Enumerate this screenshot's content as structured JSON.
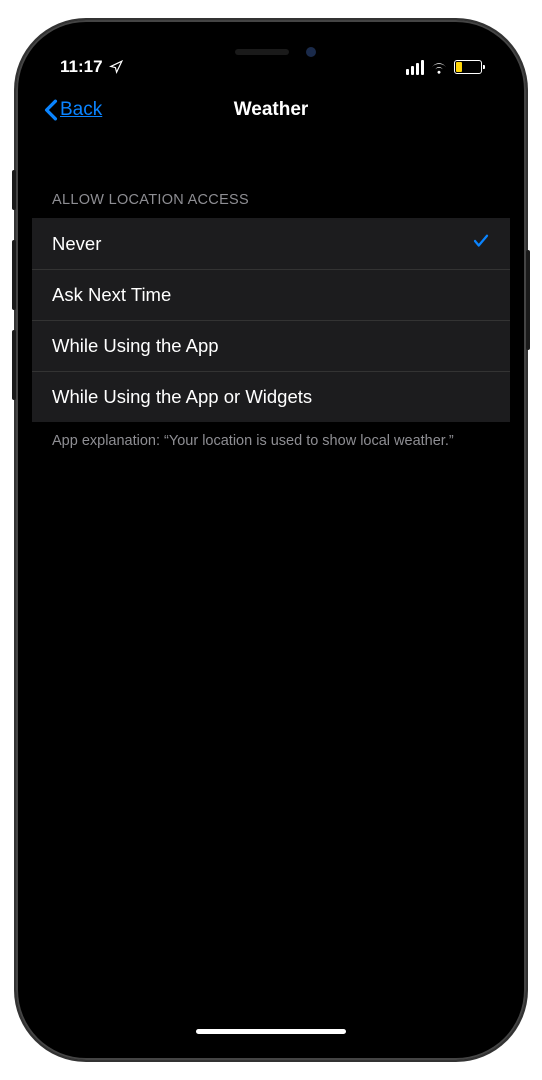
{
  "statusbar": {
    "time": "11:17"
  },
  "nav": {
    "back_label": "Back",
    "title": "Weather"
  },
  "section": {
    "header": "ALLOW LOCATION ACCESS",
    "footer": "App explanation: “Your location is used to show local weather.”"
  },
  "options": [
    {
      "label": "Never",
      "selected": true
    },
    {
      "label": "Ask Next Time",
      "selected": false
    },
    {
      "label": "While Using the App",
      "selected": false
    },
    {
      "label": "While Using the App or Widgets",
      "selected": false
    }
  ]
}
